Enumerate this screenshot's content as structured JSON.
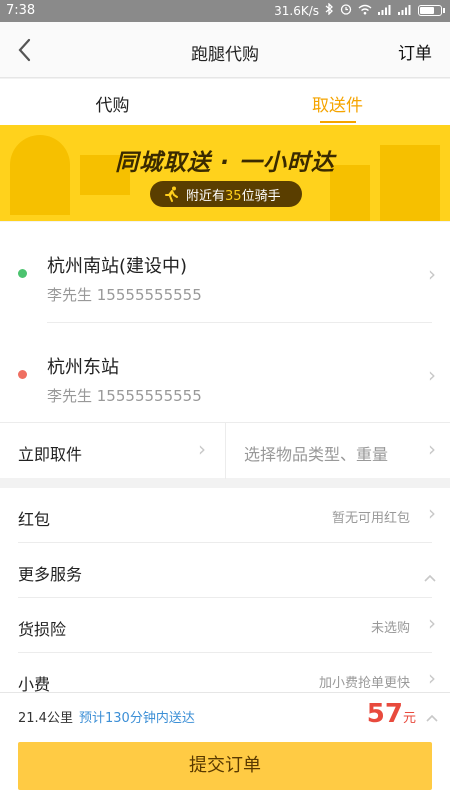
{
  "status_bar": {
    "time": "7:38",
    "speed": "31.6K/s"
  },
  "nav": {
    "back_icon": "chevron-left-icon",
    "title": "跑腿代购",
    "right_label": "订单"
  },
  "tabs": [
    {
      "label": "代购"
    },
    {
      "label": "取送件"
    }
  ],
  "banner": {
    "title": "同城取送 · 一小时达",
    "pill_prefix": "附近有",
    "pill_count": "35",
    "pill_suffix": "位骑手"
  },
  "addresses": [
    {
      "name": "杭州南站(建设中)",
      "contact": "李先生 15555555555",
      "dot_color": "#4cc36f"
    },
    {
      "name": "杭州东站",
      "contact": "李先生 15555555555",
      "dot_color": "#ef6f62"
    }
  ],
  "pickup": {
    "left": "立即取件",
    "right": "选择物品类型、重量"
  },
  "list": [
    {
      "label": "红包",
      "value": "暂无可用红包",
      "chevron": "chevron-right-icon"
    },
    {
      "label": "更多服务",
      "value": "",
      "chevron": "chevron-up-icon"
    },
    {
      "label": "货损险",
      "value": "未选购",
      "chevron": "chevron-right-icon"
    },
    {
      "label": "小费",
      "value": "加小费抢单更快",
      "chevron": "chevron-right-icon"
    }
  ],
  "footer": {
    "distance": "21.4公里",
    "eta": "预计130分钟内送达",
    "price": "57",
    "price_unit": "元",
    "submit_label": "提交订单"
  },
  "colors": {
    "accent": "#f5a400",
    "banner": "#ffd21c",
    "submit": "#ffcb44",
    "price": "#e84a3d",
    "link": "#3c8fd6"
  }
}
